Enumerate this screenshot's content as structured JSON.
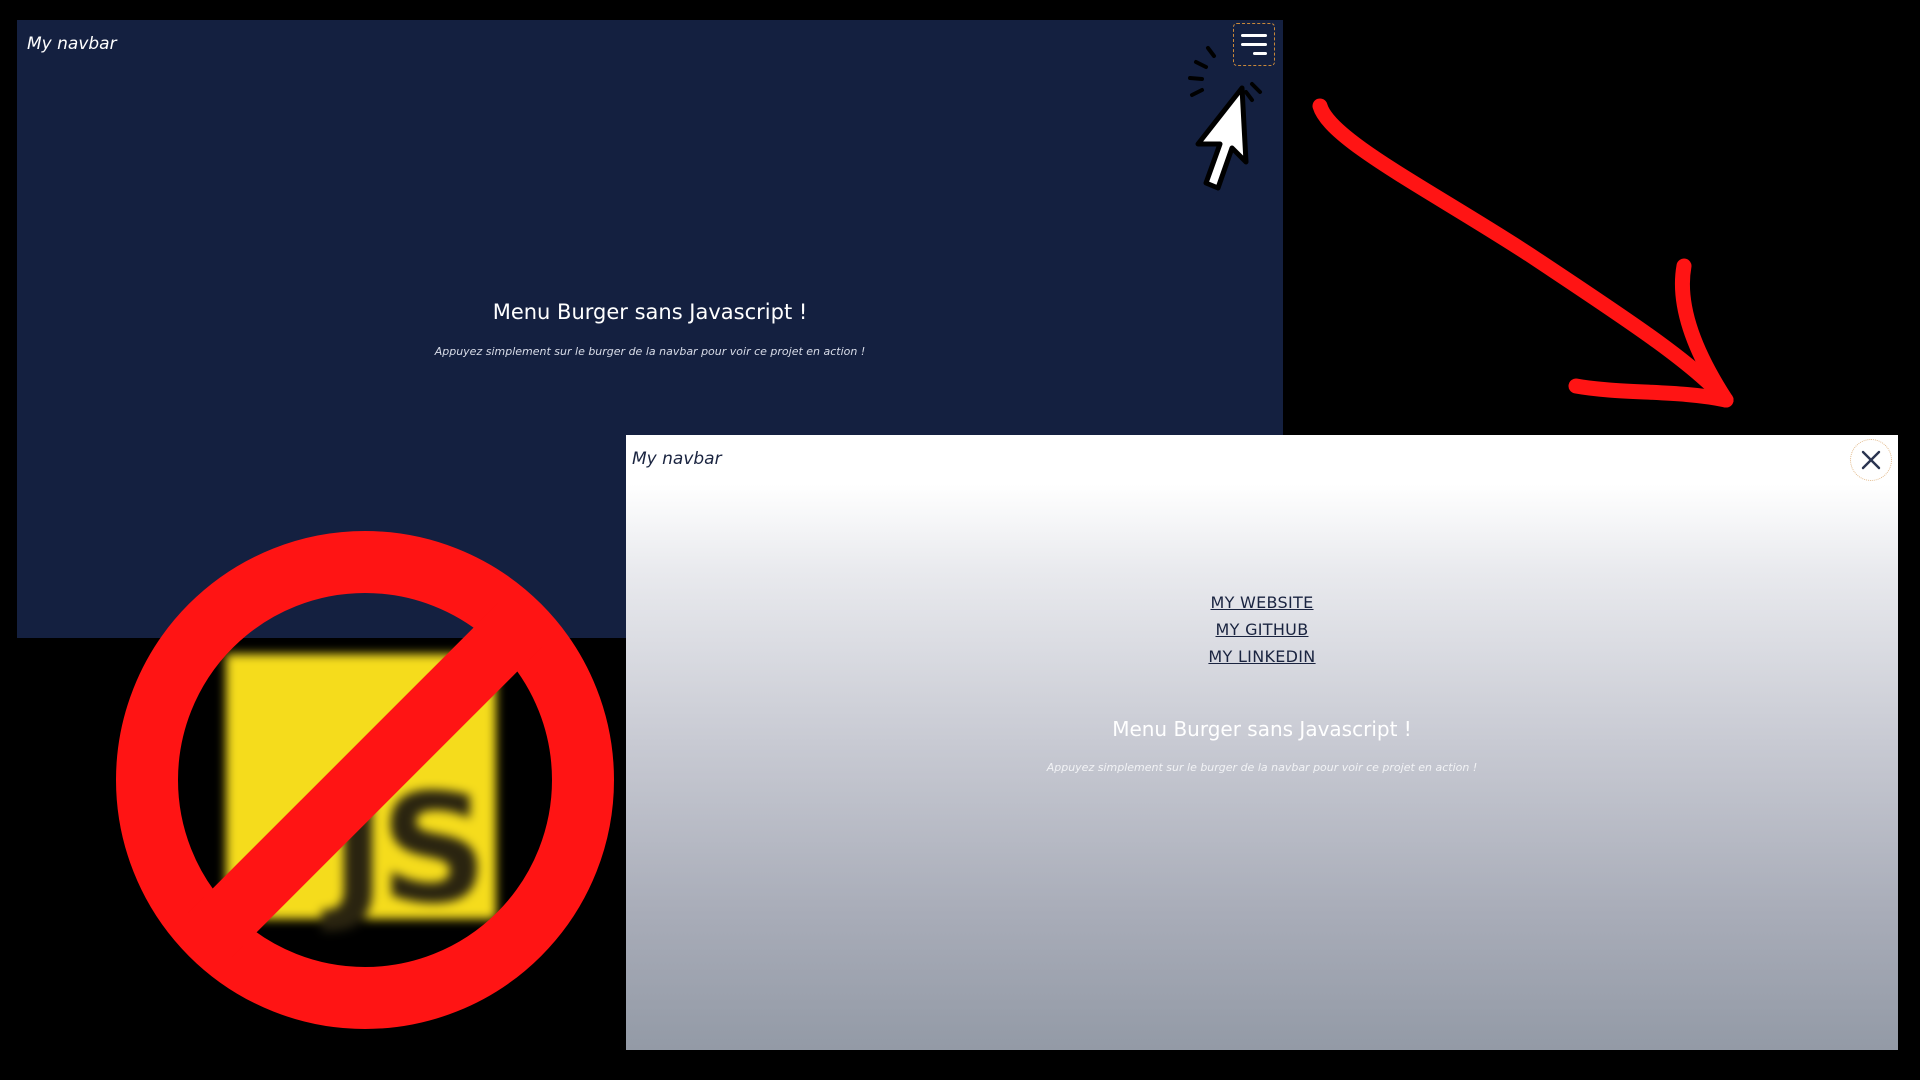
{
  "dark_screen": {
    "brand": "My navbar",
    "title": "Menu Burger sans Javascript !",
    "subtitle": "Appuyez simplement sur le burger de la navbar pour voir ce projet en action !"
  },
  "menu_screen": {
    "brand": "My navbar",
    "links": [
      "MY WEBSITE",
      "MY GITHUB",
      "MY LINKEDIN"
    ],
    "title": "Menu Burger sans Javascript !",
    "subtitle": "Appuyez simplement sur le burger de la navbar pour voir ce projet en action !"
  },
  "icons": {
    "burger": "burger-menu-icon",
    "close": "close-icon",
    "cursor": "mouse-pointer-icon",
    "arrow": "red-arrow-icon",
    "no_js": "no-javascript-icon"
  },
  "colors": {
    "page_background": "#000000",
    "dark_screen_bg": "#142040",
    "accent_red": "#ff1414",
    "js_yellow": "#f5dc1c",
    "navy_text": "#1a2440"
  }
}
